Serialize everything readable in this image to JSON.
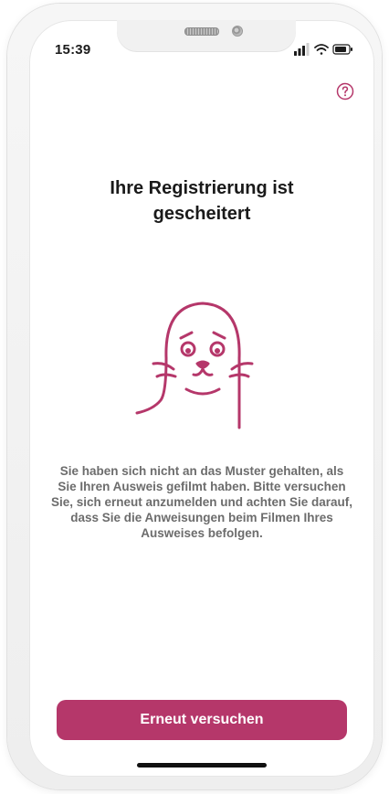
{
  "status_bar": {
    "time": "15:39",
    "icons": [
      "signal-icon",
      "wifi-icon",
      "battery-icon"
    ]
  },
  "header": {
    "help_icon": "help-circle-icon"
  },
  "main": {
    "title": "Ihre Registrierung ist gescheitert",
    "illustration": "seal-mascot-icon",
    "description": "Sie haben sich nicht an das Muster gehalten, als Sie Ihren Ausweis gefilmt haben. Bitte versuchen Sie, sich erneut anzumelden und achten Sie darauf, dass Sie die Anweisungen beim Filmen Ihres Ausweises befolgen."
  },
  "actions": {
    "retry_label": "Erneut versuchen"
  },
  "colors": {
    "accent": "#b5376a",
    "title_text": "#1a1a1a",
    "body_text": "#6c6c6c"
  }
}
